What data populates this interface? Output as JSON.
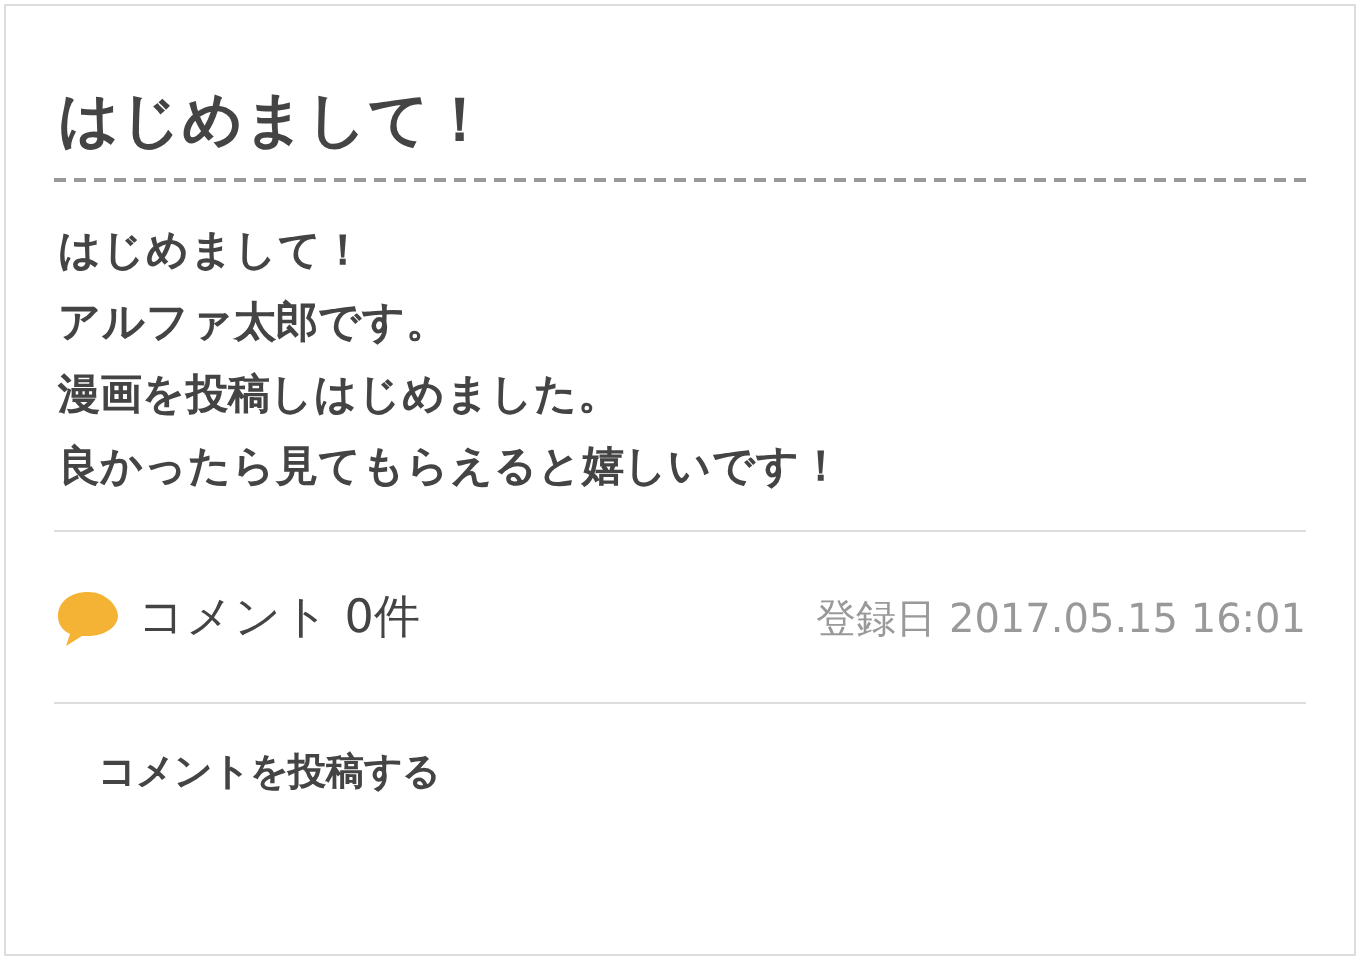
{
  "post": {
    "title": "はじめまして！",
    "body": [
      "はじめまして！",
      "アルファ太郎です。",
      "漫画を投稿しはじめました。",
      "良かったら見てもらえると嬉しいです！"
    ],
    "comments": "コメント 0件",
    "registered": "登録日 2017.05.15 16:01",
    "post_comment": "コメントを投稿する"
  }
}
